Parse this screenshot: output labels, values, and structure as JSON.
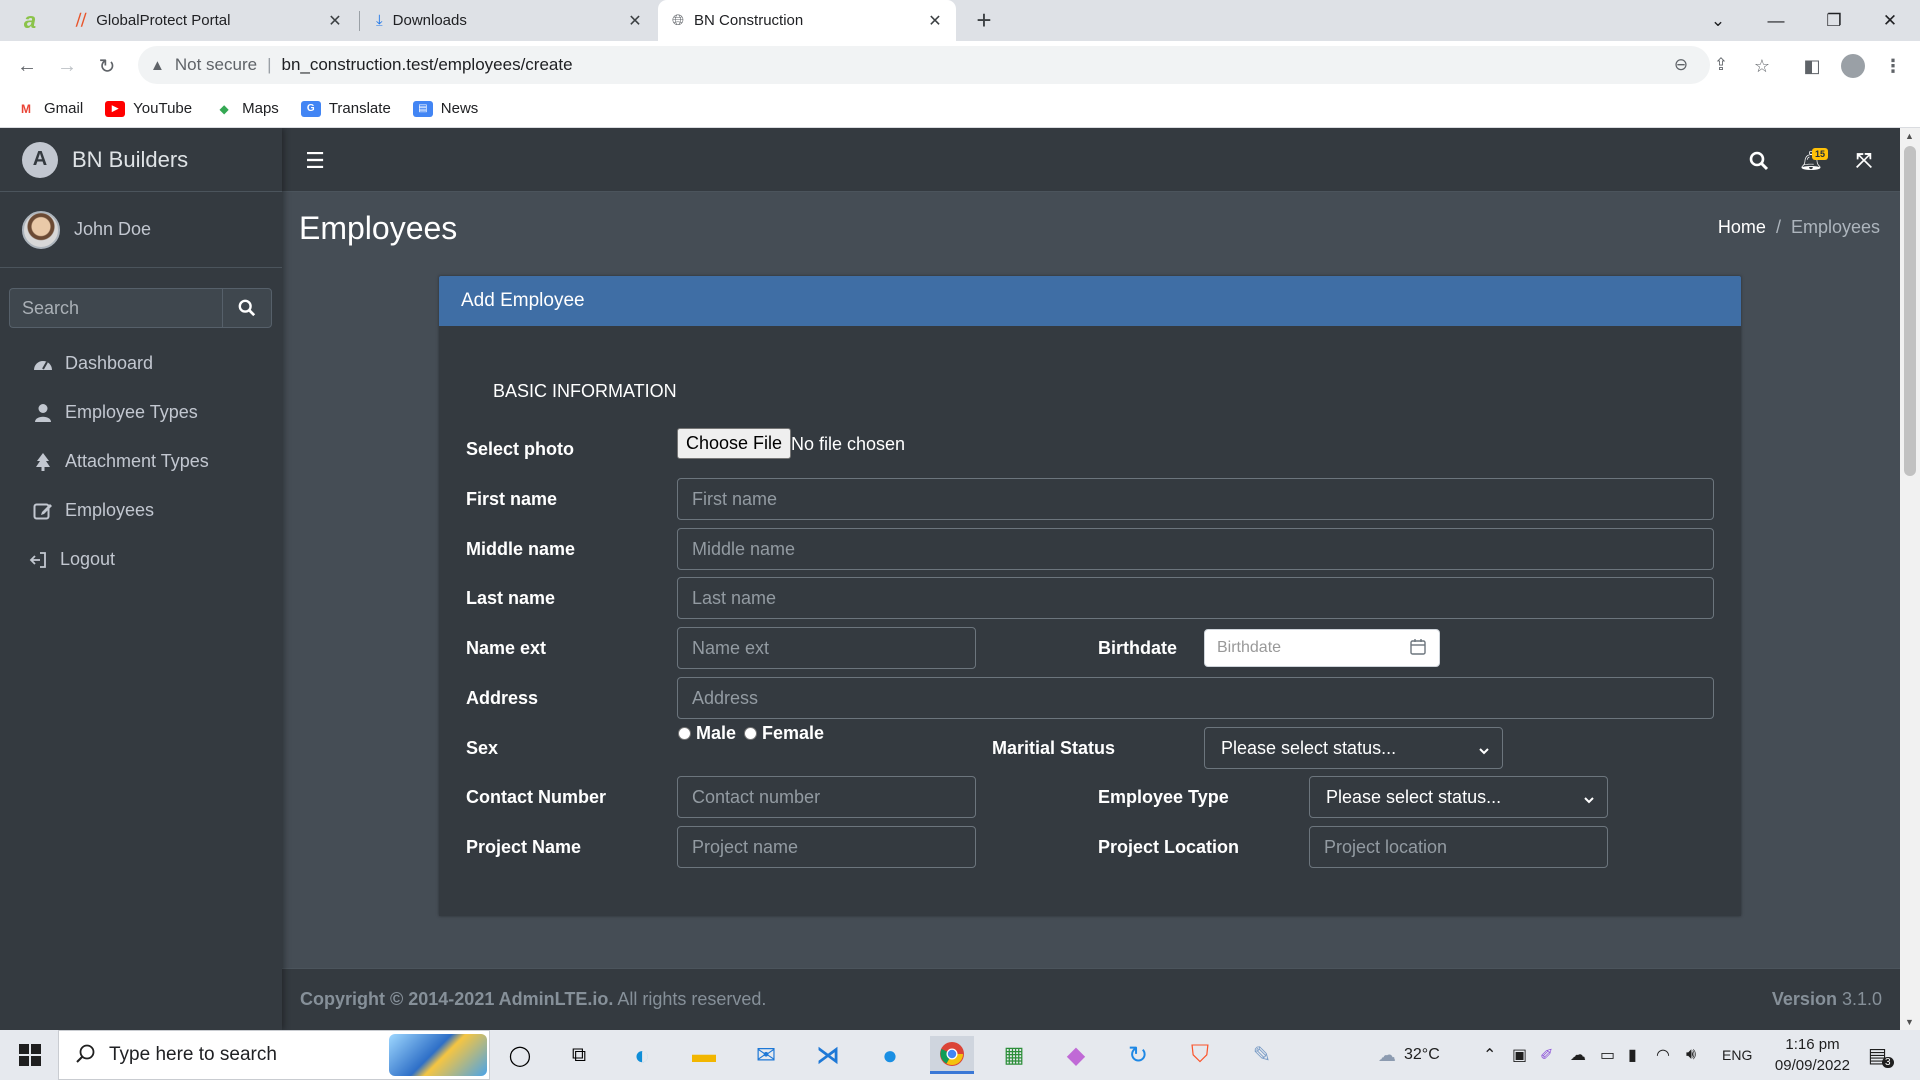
{
  "browser": {
    "tabs": [
      {
        "title": "GlobalProtect Portal",
        "active": false
      },
      {
        "title": "Downloads",
        "active": false
      },
      {
        "title": "BN Construction",
        "active": true
      }
    ],
    "new_tab_label": "+",
    "security_label": "Not secure",
    "url": "bn_construction.test/employees/create",
    "bookmarks": [
      "Gmail",
      "YouTube",
      "Maps",
      "Translate",
      "News"
    ]
  },
  "app": {
    "brand": "BN Builders",
    "user_name": "John Doe",
    "search_placeholder": "Search",
    "menu": [
      {
        "label": "Dashboard",
        "icon": "dashboard-icon"
      },
      {
        "label": "Employee Types",
        "icon": "user-icon"
      },
      {
        "label": "Attachment Types",
        "icon": "tree-icon"
      },
      {
        "label": "Employees",
        "icon": "edit-icon"
      },
      {
        "label": "Logout",
        "icon": "logout-icon"
      }
    ],
    "notifications_count": "15",
    "page_title": "Employees",
    "breadcrumb": {
      "home": "Home",
      "current": "Employees"
    }
  },
  "form": {
    "card_title": "Add Employee",
    "section": "BASIC INFORMATION",
    "labels": {
      "photo": "Select photo",
      "first_name": "First name",
      "middle_name": "Middle name",
      "last_name": "Last name",
      "name_ext": "Name ext",
      "birthdate": "Birthdate",
      "address": "Address",
      "sex": "Sex",
      "marital_status": "Maritial Status",
      "contact": "Contact Number",
      "employee_type": "Employee Type",
      "project_name": "Project Name",
      "project_location": "Project Location"
    },
    "placeholders": {
      "first_name": "First name",
      "middle_name": "Middle name",
      "last_name": "Last name",
      "name_ext": "Name ext",
      "birthdate": "Birthdate",
      "address": "Address",
      "contact": "Contact number",
      "project_name": "Project name",
      "project_location": "Project location"
    },
    "file_button": "Choose File",
    "file_status": "No file chosen",
    "sex_options": [
      "Male",
      "Female"
    ],
    "marital_status_value": "Please select status...",
    "employee_type_value": "Please select status..."
  },
  "footer": {
    "copyright_bold": "Copyright © 2014-2021 AdminLTE.io.",
    "copyright_rest": "All rights reserved.",
    "version_label": "Version",
    "version": "3.1.0"
  },
  "taskbar": {
    "search_placeholder": "Type here to search",
    "weather": "32°C",
    "language": "ENG",
    "time": "1:16 pm",
    "date": "09/09/2022",
    "notification_count": "3"
  }
}
